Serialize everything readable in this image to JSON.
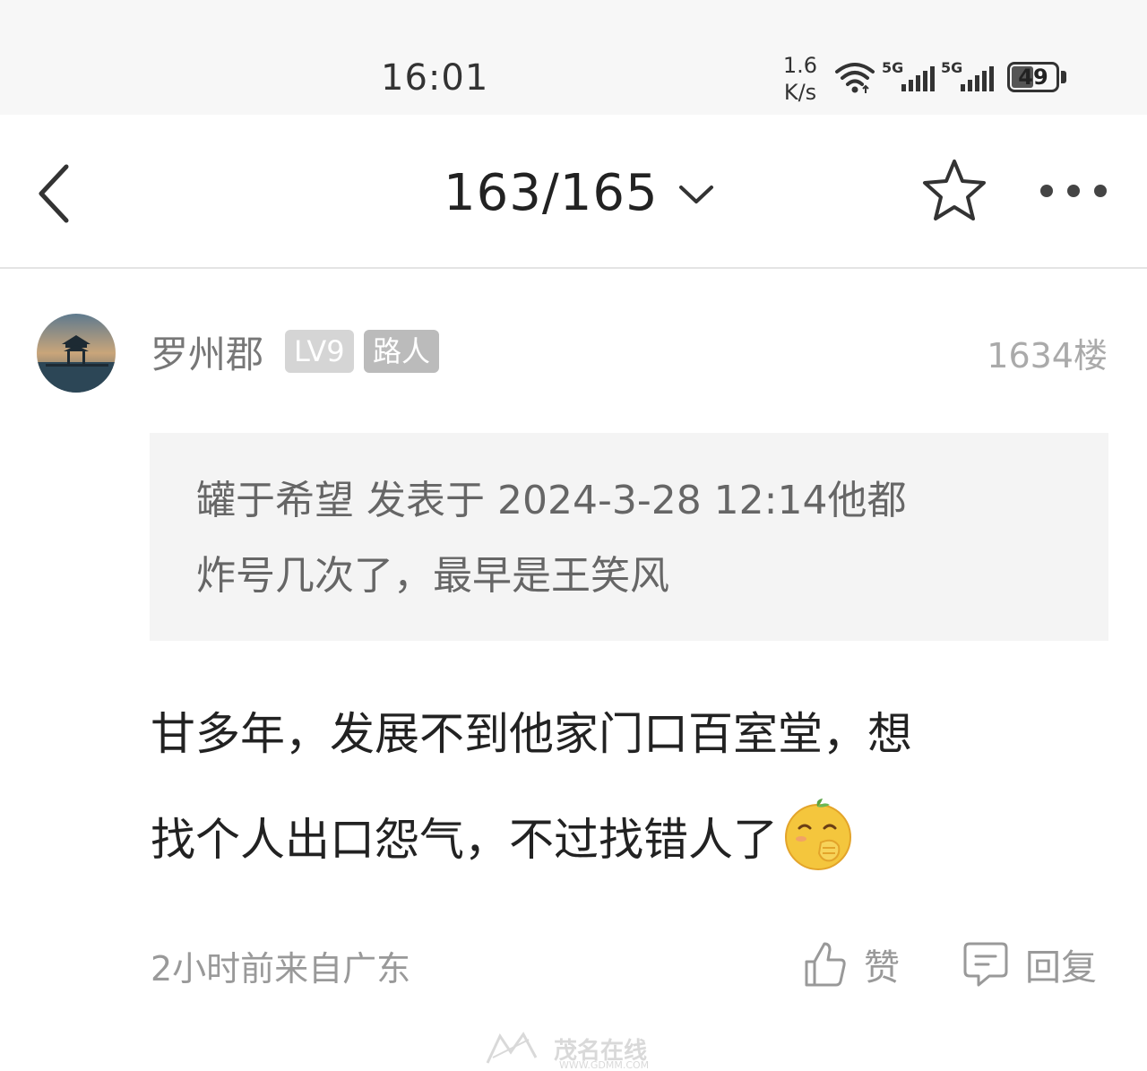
{
  "status_bar": {
    "time": "16:01",
    "net_speed_value": "1.6",
    "net_speed_unit": "K/s",
    "sim1_tag": "5G",
    "sim2_tag": "5G",
    "battery_level": "49",
    "battery_fraction": 0.49
  },
  "nav": {
    "page_indicator": "163/165"
  },
  "post": {
    "author": "罗州郡",
    "level_badge": "LV9",
    "role_badge": "路人",
    "floor": "1634楼",
    "quote_line1": "罐于希望 发表于 2024-3-28 12:14他都",
    "quote_line2": "炸号几次了，最早是王笑风",
    "body_line1": "甘多年，发展不到他家门口百室堂，想",
    "body_line2": "找个人出口怨气，不过找错人了",
    "meta": "2小时前来自广东",
    "like_label": "赞",
    "reply_label": "回复"
  },
  "watermark": {
    "text": "茂名在线",
    "url": "WWW.GDMM.COM"
  },
  "icons": {
    "back": "back-arrow-icon",
    "dropdown": "chevron-down-icon",
    "favorite": "star-icon",
    "more": "more-dots-icon",
    "like": "thumbs-up-icon",
    "reply": "comment-icon",
    "emoji": "giggle-emoji-icon"
  }
}
